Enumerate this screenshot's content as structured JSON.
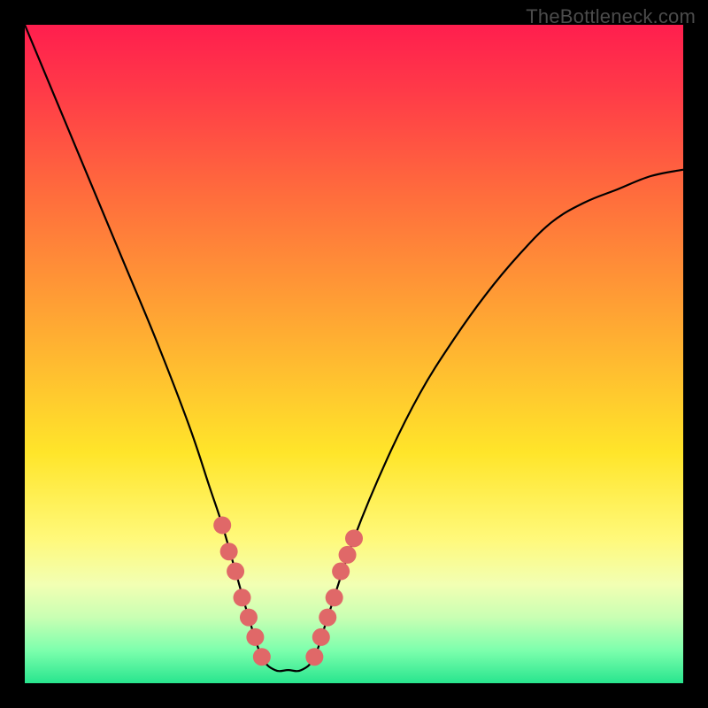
{
  "watermark": "TheBottleneck.com",
  "chart_data": {
    "type": "line",
    "title": "",
    "xlabel": "",
    "ylabel": "",
    "xlim": [
      0,
      100
    ],
    "ylim": [
      0,
      100
    ],
    "series": [
      {
        "name": "curve",
        "x": [
          0,
          5,
          10,
          15,
          20,
          25,
          28,
          30,
          32,
          34,
          36,
          38,
          40,
          42,
          44,
          46,
          50,
          55,
          60,
          65,
          70,
          75,
          80,
          85,
          90,
          95,
          100
        ],
        "y": [
          100,
          88,
          76,
          64,
          52,
          39,
          30,
          24,
          17,
          10,
          4,
          2,
          2,
          2,
          4,
          10,
          22,
          34,
          44,
          52,
          59,
          65,
          70,
          73,
          75,
          77,
          78
        ]
      }
    ],
    "markers": {
      "left": [
        [
          30,
          24
        ],
        [
          31,
          20
        ],
        [
          32,
          17
        ],
        [
          33,
          13
        ],
        [
          34,
          10
        ],
        [
          35,
          7
        ],
        [
          36,
          4
        ]
      ],
      "right": [
        [
          44,
          4
        ],
        [
          45,
          7
        ],
        [
          46,
          10
        ],
        [
          47,
          13
        ],
        [
          48,
          17
        ],
        [
          49,
          19.5
        ],
        [
          50,
          22
        ]
      ]
    },
    "marker_color": "#e06868",
    "curve_color": "#000000"
  }
}
